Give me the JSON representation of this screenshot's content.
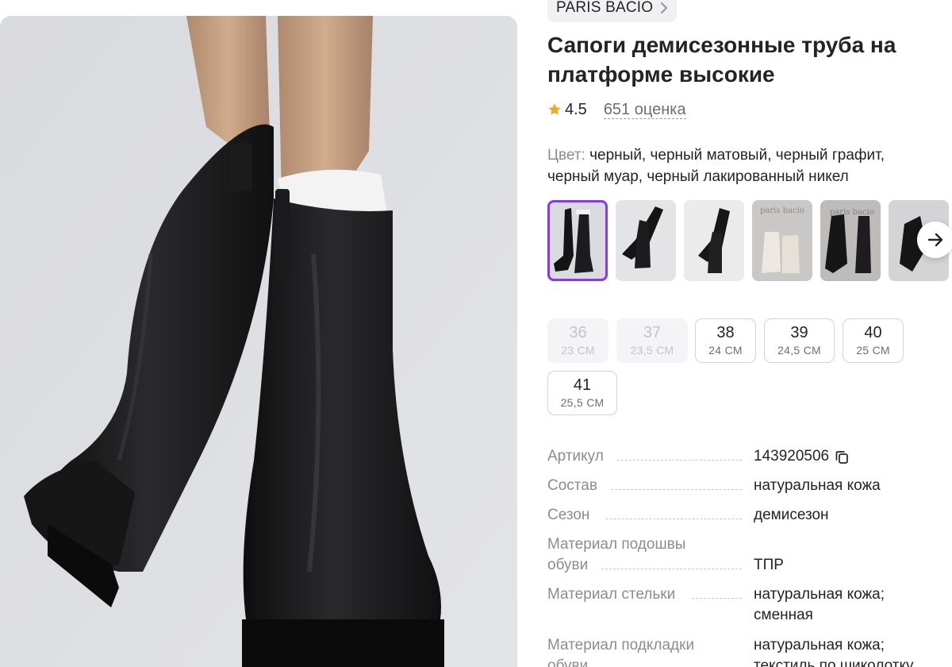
{
  "product": {
    "brand": "PARIS BACIO",
    "title": "Сапоги демисезонные труба на платформе высокие",
    "rating": "4.5",
    "reviews": "651 оценка",
    "color_label": "Цвет:",
    "color_value": "черный, черный матовый, черный графит, черный муар, черный лакированный никел"
  },
  "swatches": [
    {
      "name": "черный",
      "selected": true
    },
    {
      "name": "черный матовый",
      "selected": false
    },
    {
      "name": "черный графит",
      "selected": false
    },
    {
      "name": "черный муар",
      "selected": false,
      "watermark": "paris bacio"
    },
    {
      "name": "черный лакированный никел",
      "selected": false,
      "watermark": "paris bacio"
    },
    {
      "name": "more",
      "selected": false
    }
  ],
  "sizes": [
    {
      "size": "36",
      "cm": "23 СМ",
      "available": false
    },
    {
      "size": "37",
      "cm": "23,5 СМ",
      "available": false
    },
    {
      "size": "38",
      "cm": "24 СМ",
      "available": true
    },
    {
      "size": "39",
      "cm": "24,5 СМ",
      "available": true
    },
    {
      "size": "40",
      "cm": "25 СМ",
      "available": true
    },
    {
      "size": "41",
      "cm": "25,5 СМ",
      "available": true
    }
  ],
  "specs": [
    {
      "key": "Артикул",
      "value": "143920506",
      "copy": true
    },
    {
      "key": "Состав",
      "value": "натуральная кожа"
    },
    {
      "key": "Сезон",
      "value": "демисезон"
    },
    {
      "key": "Материал подошвы обуви",
      "value": "ТПР"
    },
    {
      "key": "Материал стельки",
      "value": "натуральная кожа; сменная"
    },
    {
      "key": "Материал подкладки обуви",
      "value": "натуральная кожа; текстиль по шиколотку"
    }
  ],
  "colors": {
    "accent": "#8b36f0",
    "star": "#f5a623",
    "muted": "#8b8b95"
  },
  "icons": {
    "brand_chevron": "chevron-right-icon",
    "star": "star-icon",
    "next": "arrow-right-icon",
    "copy": "copy-icon"
  }
}
